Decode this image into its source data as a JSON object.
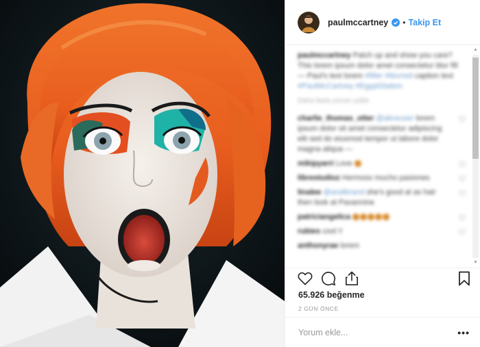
{
  "post": {
    "username": "paulmccartney",
    "verified_icon": "verified-badge-icon",
    "separator": "•",
    "follow_label": "Takip Et",
    "likes_text": "65.926 beğenme",
    "timestamp": "2 GÜN ÖNCE",
    "comment_placeholder": "Yorum ekle...",
    "more_label": "•••"
  },
  "colors": {
    "accent": "#3897f0",
    "text": "#262626",
    "muted": "#999999",
    "border": "#efefef"
  },
  "icons": {
    "like": "heart-icon",
    "comment": "comment-bubble-icon",
    "share": "share-icon",
    "save": "bookmark-icon",
    "scroll_up": "▲",
    "scroll_down": "▼"
  }
}
